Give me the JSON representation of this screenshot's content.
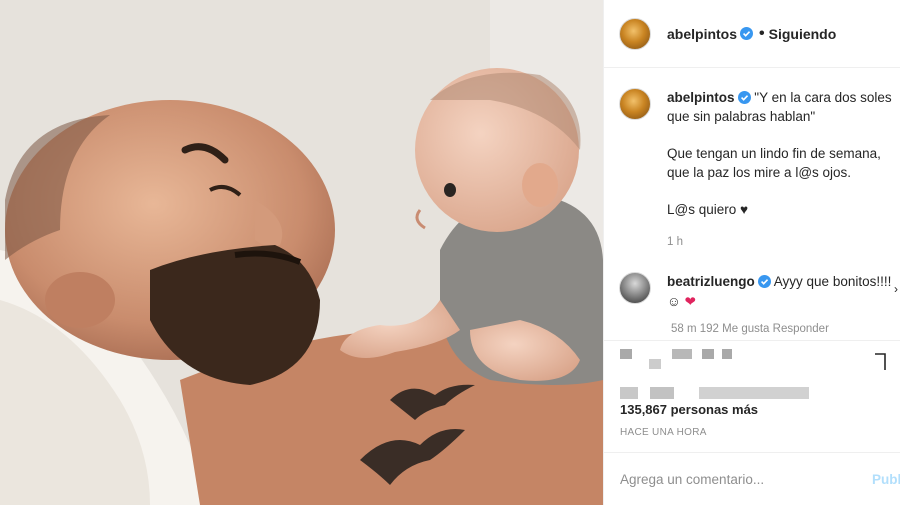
{
  "photo": {
    "alt_subject": "man-and-baby-photo"
  },
  "header": {
    "username": "abelpintos",
    "separator": "•",
    "follow_label": "Siguiendo"
  },
  "caption": {
    "username": "abelpintos",
    "line1": "\"Y en la cara dos soles que sin palabras hablan\"",
    "line2": "Que tengan un lindo fin de semana, que la paz los mire a l@s ojos.",
    "line3": "L@s quiero ♥",
    "time": "1 h"
  },
  "comment": {
    "username": "beatrizluengo",
    "text": "Ayyy que bonitos!!!! ☺",
    "heart": "❤",
    "meta": "58 m   192 Me gusta   Responder"
  },
  "likes": {
    "text": "135,867 personas más"
  },
  "posted": {
    "text": "HACE UNA HORA"
  },
  "add_comment": {
    "placeholder": "Agrega un comentario...",
    "publish_label": "Publ"
  },
  "colors": {
    "verified": "#3897f0",
    "link": "#b2dffc",
    "heart": "#e0245e"
  },
  "icons": [
    "verified-badge-icon",
    "bookmark-icon",
    "heart-icon",
    "chevron-icon"
  ]
}
